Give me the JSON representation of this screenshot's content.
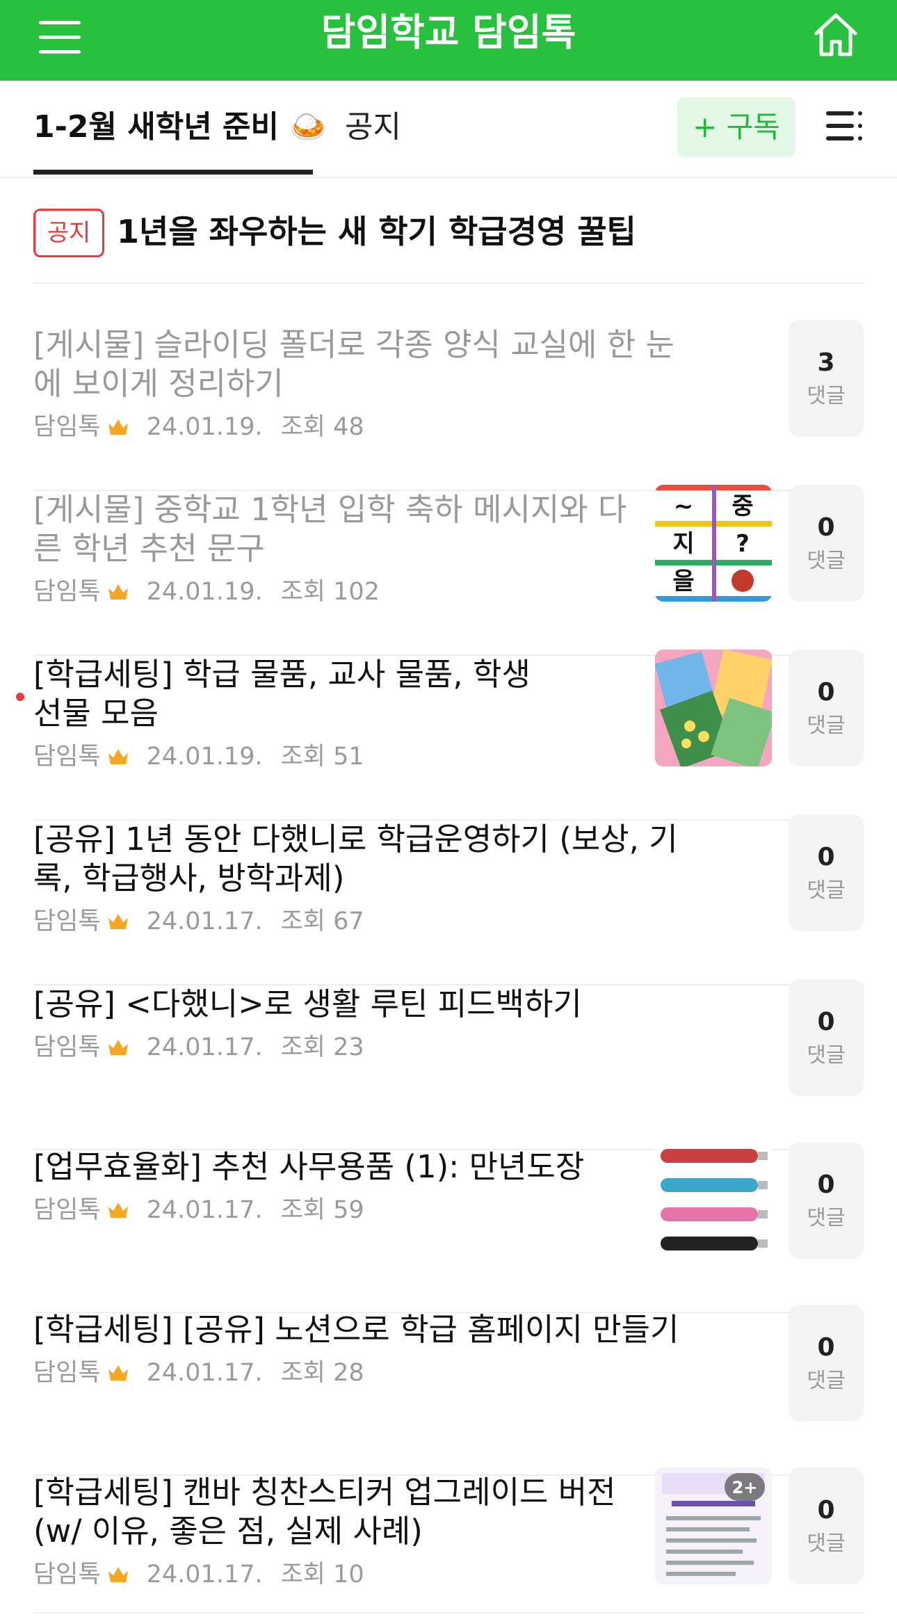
{
  "header": {
    "title": "담임학교 담임톡",
    "menu_icon": "hamburger-icon",
    "home_icon": "home-icon"
  },
  "tabs": {
    "active_label": "1-2월 새학년 준비 🍛",
    "notice_label": "공지",
    "subscribe_label": "+ 구독"
  },
  "notice": {
    "badge": "공지",
    "title": "1년을 좌우하는 새 학기 학급경영 꿀팁"
  },
  "posts": [
    {
      "title": "[게시물] 슬라이딩 폴더로 각종 양식 교실에 한 눈에 보이게 정리하기",
      "author": "담임톡",
      "date": "24.01.19.",
      "views": "조회 48",
      "comments": "3",
      "comment_label": "댓글",
      "read": true,
      "thumbnail": "none"
    },
    {
      "title": "[게시물] 중학교 1학년 입학 축하 메시지와 다른 학년 추천 문구",
      "author": "담임톡",
      "date": "24.01.19.",
      "views": "조회 102",
      "comments": "0",
      "comment_label": "댓글",
      "read": true,
      "thumbnail": "letter-card-image",
      "thumb_text": [
        "~",
        "중",
        "지",
        "?",
        "을"
      ]
    },
    {
      "title": "[학급세팅] 학급 물품, 교사 물품, 학생 선물 모음",
      "author": "담임톡",
      "date": "24.01.19.",
      "views": "조회 51",
      "comments": "0",
      "comment_label": "댓글",
      "read": false,
      "thumbnail": "colorful-cards-image"
    },
    {
      "title": "[공유] 1년 동안 다했니로 학급운영하기 (보상, 기록, 학급행사, 방학과제)",
      "author": "담임톡",
      "date": "24.01.17.",
      "views": "조회 67",
      "comments": "0",
      "comment_label": "댓글",
      "read": false,
      "thumbnail": "none"
    },
    {
      "title": "[공유] <다했니>로 생활 루틴 피드백하기",
      "author": "담임톡",
      "date": "24.01.17.",
      "views": "조회 23",
      "comments": "0",
      "comment_label": "댓글",
      "read": false,
      "thumbnail": "none"
    },
    {
      "title": "[업무효율화] 추천 사무용품 (1): 만년도장",
      "author": "담임톡",
      "date": "24.01.17.",
      "views": "조회 59",
      "comments": "0",
      "comment_label": "댓글",
      "read": false,
      "thumbnail": "stamps-image"
    },
    {
      "title": "[학급세팅] [공유] 노션으로 학급 홈페이지 만들기",
      "author": "담임톡",
      "date": "24.01.17.",
      "views": "조회 28",
      "comments": "0",
      "comment_label": "댓글",
      "read": false,
      "thumbnail": "none"
    },
    {
      "title": "[학급세팅] 캔바 칭찬스티커 업그레이드 버전 (w/ 이유, 좋은 점, 실제 사례)",
      "author": "담임톡",
      "date": "24.01.17.",
      "views": "조회 10",
      "comments": "0",
      "comment_label": "댓글",
      "read": false,
      "thumbnail": "sticker-doc-image",
      "thumb_badge": "2+"
    }
  ],
  "colors": {
    "brand_green": "#28c13d",
    "notice_red": "#e83a3a",
    "subscribe_bg": "#e3f7e7"
  }
}
